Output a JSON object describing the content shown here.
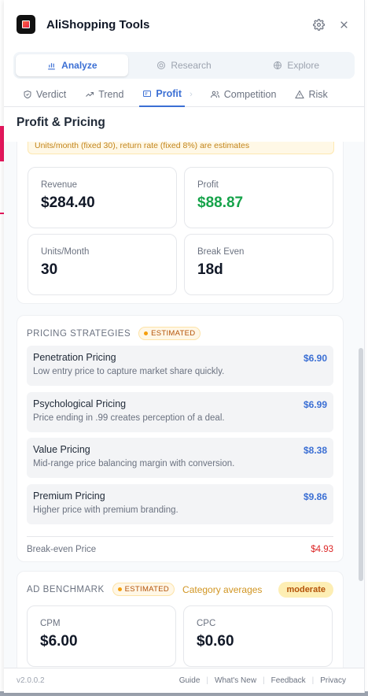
{
  "header": {
    "title": "AliShopping Tools"
  },
  "mode_tabs": [
    {
      "label": "Analyze",
      "icon": "bar-chart-icon",
      "active": true
    },
    {
      "label": "Research",
      "icon": "target-icon",
      "active": false
    },
    {
      "label": "Explore",
      "icon": "globe-icon",
      "active": false
    }
  ],
  "sub_tabs": [
    {
      "label": "Verdict",
      "icon": "shield-check-icon"
    },
    {
      "label": "Trend",
      "icon": "trending-up-icon"
    },
    {
      "label": "Profit",
      "icon": "receipt-icon",
      "active": true
    },
    {
      "label": "Competition",
      "icon": "users-icon"
    },
    {
      "label": "Risk",
      "icon": "warning-icon"
    }
  ],
  "section_title": "Profit & Pricing",
  "profit": {
    "note": "Units/month (fixed 30), return rate (fixed 8%) are estimates",
    "metrics": [
      {
        "label": "Revenue",
        "value": "$284.40"
      },
      {
        "label": "Profit",
        "value": "$88.87"
      },
      {
        "label": "Units/Month",
        "value": "30"
      },
      {
        "label": "Break Even",
        "value": "18d"
      }
    ]
  },
  "pricing": {
    "title": "PRICING STRATEGIES",
    "badge": "ESTIMATED",
    "strategies": [
      {
        "name": "Penetration Pricing",
        "desc": "Low entry price to capture market share quickly.",
        "price": "$6.90"
      },
      {
        "name": "Psychological Pricing",
        "desc": "Price ending in .99 creates perception of a deal.",
        "price": "$6.99"
      },
      {
        "name": "Value Pricing",
        "desc": "Mid-range price balancing margin with conversion.",
        "price": "$8.38"
      },
      {
        "name": "Premium Pricing",
        "desc": "Higher price with premium branding.",
        "price": "$9.86"
      }
    ],
    "breakeven_label": "Break-even Price",
    "breakeven_value": "$4.93"
  },
  "ads": {
    "title": "AD BENCHMARK",
    "badge": "ESTIMATED",
    "subtitle": "Category averages",
    "level": "moderate",
    "metrics": [
      {
        "label": "CPM",
        "value": "$6.00"
      },
      {
        "label": "CPC",
        "value": "$0.60"
      }
    ]
  },
  "footer": {
    "version": "v2.0.0.2",
    "links": [
      "Guide",
      "What's New",
      "Feedback",
      "Privacy"
    ]
  },
  "colors": {
    "accent": "#3b6fd4",
    "profit_green": "#16a34a",
    "danger": "#dc2626",
    "warning": "#f59e0b"
  }
}
